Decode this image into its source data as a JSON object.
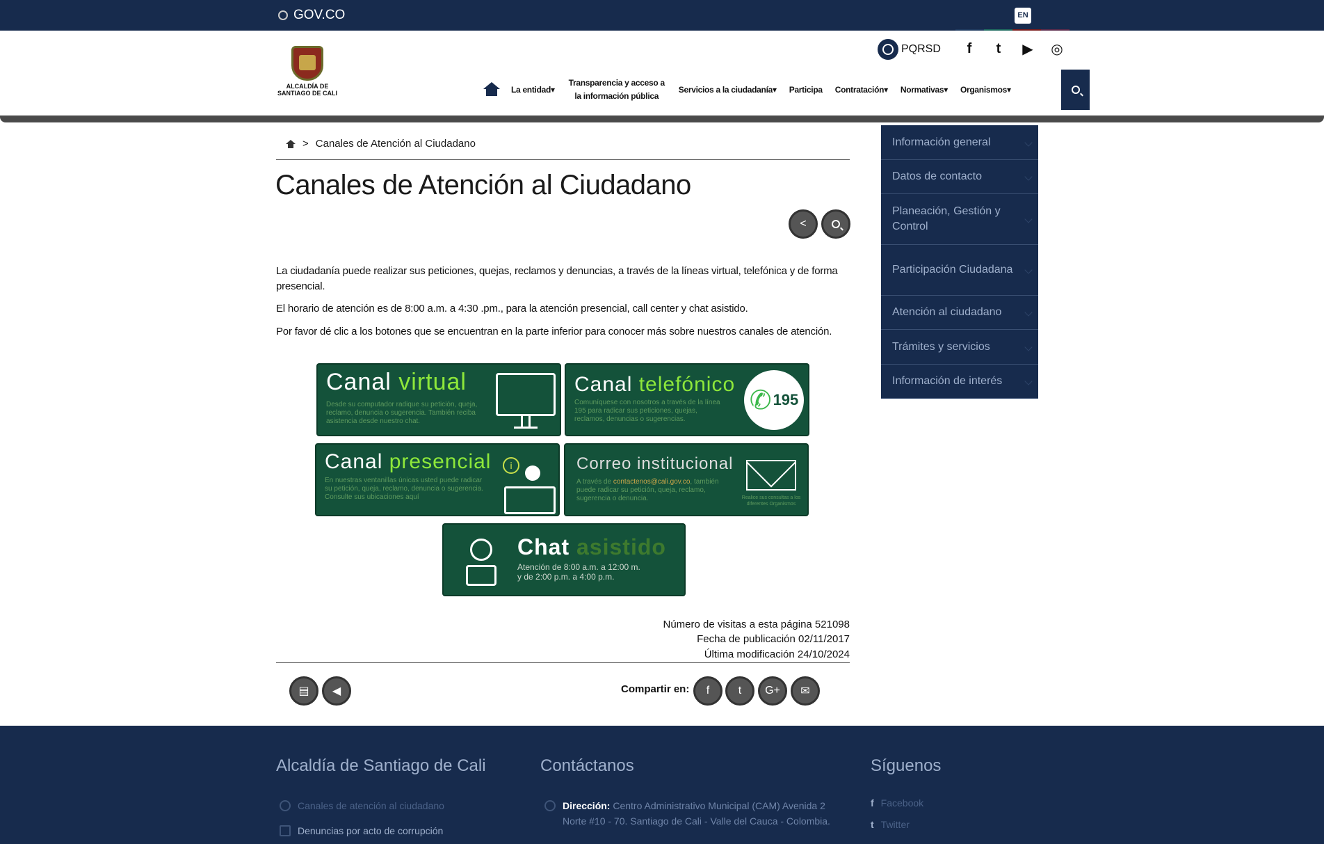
{
  "topbar": {
    "govco": "GOV.CO",
    "lang": "EN",
    "stripes": [
      "#1f3a5f",
      "#1d6a5e",
      "#7a1c1c",
      "#5a2a4a"
    ]
  },
  "header": {
    "logo_line1": "ALCALDÍA DE",
    "logo_line2": "SANTIAGO DE CALI",
    "pqrsd": "PQRSD",
    "social": [
      "f",
      "t",
      "▶",
      "◎"
    ]
  },
  "nav": {
    "items": [
      "La entidad",
      "Transparencia y acceso a la información pública",
      "Servicios a la ciudadanía",
      "Participa",
      "Contratación",
      "Normativas",
      "Organismos"
    ]
  },
  "breadcrumb": {
    "current": "Canales de Atención al Ciudadano",
    "sep": ">"
  },
  "page": {
    "title": "Canales de Atención al Ciudadano",
    "p1": "La ciudadanía puede realizar sus peticiones, quejas, reclamos y denuncias, a través de la líneas virtual, telefónica y de forma presencial.",
    "p2": "El horario de atención es de 8:00 a.m. a 4:30 .pm., para la atención presencial, call center y chat asistido.",
    "p3": "Por favor dé clic a los botones que se encuentran en la parte inferior para conocer más sobre nuestros canales de atención."
  },
  "banners": {
    "virtual": {
      "a": "Canal ",
      "b": "virtual",
      "sub": "Desde su computador radique su petición, queja, reclamo, denuncia o sugerencia. También reciba asistencia desde nuestro chat."
    },
    "telefonico": {
      "a": "Canal ",
      "b": "telefónico",
      "sub": "Comuníquese con nosotros a través de la línea 195 para radicar sus peticiones, quejas, reclamos, denuncias o sugerencias.",
      "num": "195"
    },
    "presencial": {
      "a": "Canal ",
      "b": "presencial",
      "sub": "En nuestras ventanillas únicas usted puede radicar su petición, queja, reclamo, denuncia o sugerencia. Consulte sus ubicaciones aquí"
    },
    "correo": {
      "a": "Correo institucional",
      "sub_pre": "A través de ",
      "email": "contactenos@cali.gov.co",
      "sub_post": ", también puede radicar su petición, queja, reclamo, sugerencia o denuncia.",
      "note": "Realice sus consultas a los diferentes Organismos"
    },
    "chat": {
      "a": "Chat ",
      "b": "asistido",
      "l1": "Atención de 8:00 a.m. a 12:00 m.",
      "l2": "y de 2:00 p.m. a 4:00 p.m."
    }
  },
  "meta": {
    "visits": "Número de visitas a esta página 521098",
    "published": "Fecha de publicación 02/11/2017",
    "modified": "Última modificación 24/10/2024",
    "share_label": "Compartir en:"
  },
  "sidebar": {
    "items": [
      "Información general",
      "Datos de contacto",
      "Planeación, Gestión y Control",
      "Participación Ciudadana",
      "Atención al ciudadano",
      "Trámites y servicios",
      "Información de interés"
    ]
  },
  "footer": {
    "col1_title": "Alcaldía de Santiago de Cali",
    "col1_links": [
      "Canales de atención al ciudadano",
      "Denuncias por acto de corrupción"
    ],
    "col2_title": "Contáctanos",
    "address_label": "Dirección:",
    "address": "Centro Administrativo Municipal (CAM) Avenida 2 Norte #10 - 70. Santiago de Cali - Valle del Cauca - Colombia.",
    "col3_title": "Síguenos",
    "col3_links": [
      "Facebook",
      "Twitter"
    ]
  }
}
